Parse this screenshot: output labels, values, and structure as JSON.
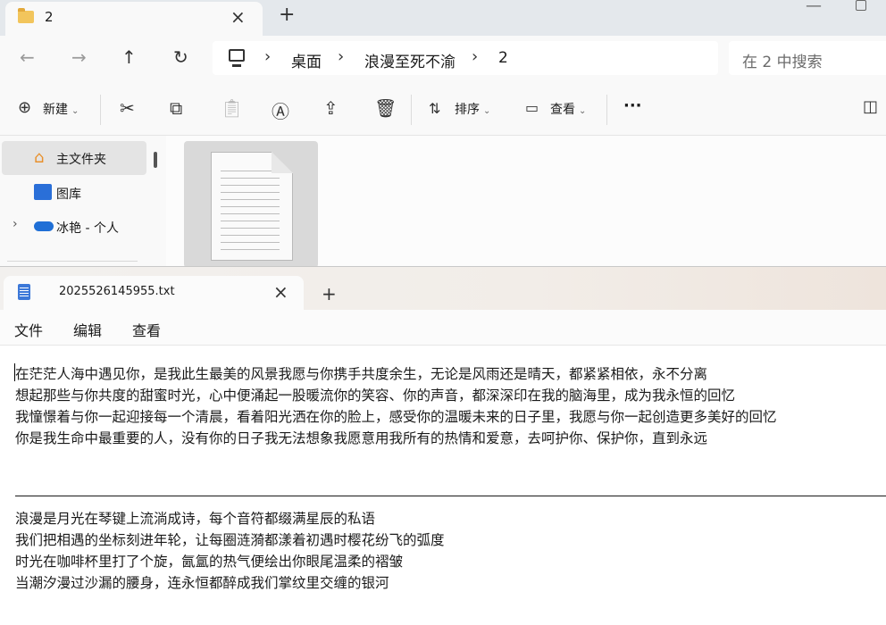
{
  "explorer": {
    "tab_title": "2",
    "tab_close": "×",
    "new_tab": "+",
    "window_minimize": "—",
    "nav": {
      "back": "←",
      "forward": "→",
      "up": "↑",
      "refresh": "↻"
    },
    "breadcrumb": [
      "桌面",
      "浪漫至死不渝",
      "2"
    ],
    "breadcrumb_sep": "›",
    "search_placeholder": "在 2 中搜索",
    "toolbar": {
      "new_label": "新建",
      "sort_label": "排序",
      "view_label": "查看",
      "more": "···"
    },
    "sidebar": {
      "home": "主文件夹",
      "gallery": "图库",
      "onedrive": "冰艳 - 个人",
      "expand": "›"
    }
  },
  "notepad": {
    "tab_title": "2025526145955.txt",
    "tab_close": "×",
    "new_tab": "+",
    "menu": [
      "文件",
      "编辑",
      "查看"
    ],
    "lines_top": [
      "在茫茫人海中遇见你，是我此生最美的风景我愿与你携手共度余生，无论是风雨还是晴天，都紧紧相依，永不分离",
      "想起那些与你共度的甜蜜时光，心中便涌起一股暖流你的笑容、你的声音，都深深印在我的脑海里，成为我永恒的回忆",
      "我憧憬着与你一起迎接每一个清晨，看着阳光洒在你的脸上，感受你的温暖未来的日子里，我愿与你一起创造更多美好的回忆",
      "你是我生命中最重要的人，没有你的日子我无法想象我愿意用我所有的热情和爱意，去呵护你、保护你，直到永远"
    ],
    "lines_bottom": [
      "浪漫是月光在琴键上流淌成诗，每个音符都缀满星辰的私语",
      "我们把相遇的坐标刻进年轮，让每圈涟漪都漾着初遇时樱花纷飞的弧度",
      "时光在咖啡杯里打了个旋，氤氲的热气便绘出你眼尾温柔的褶皱",
      "当潮汐漫过沙漏的腰身，连永恒都醉成我们掌纹里交缠的银河"
    ]
  }
}
